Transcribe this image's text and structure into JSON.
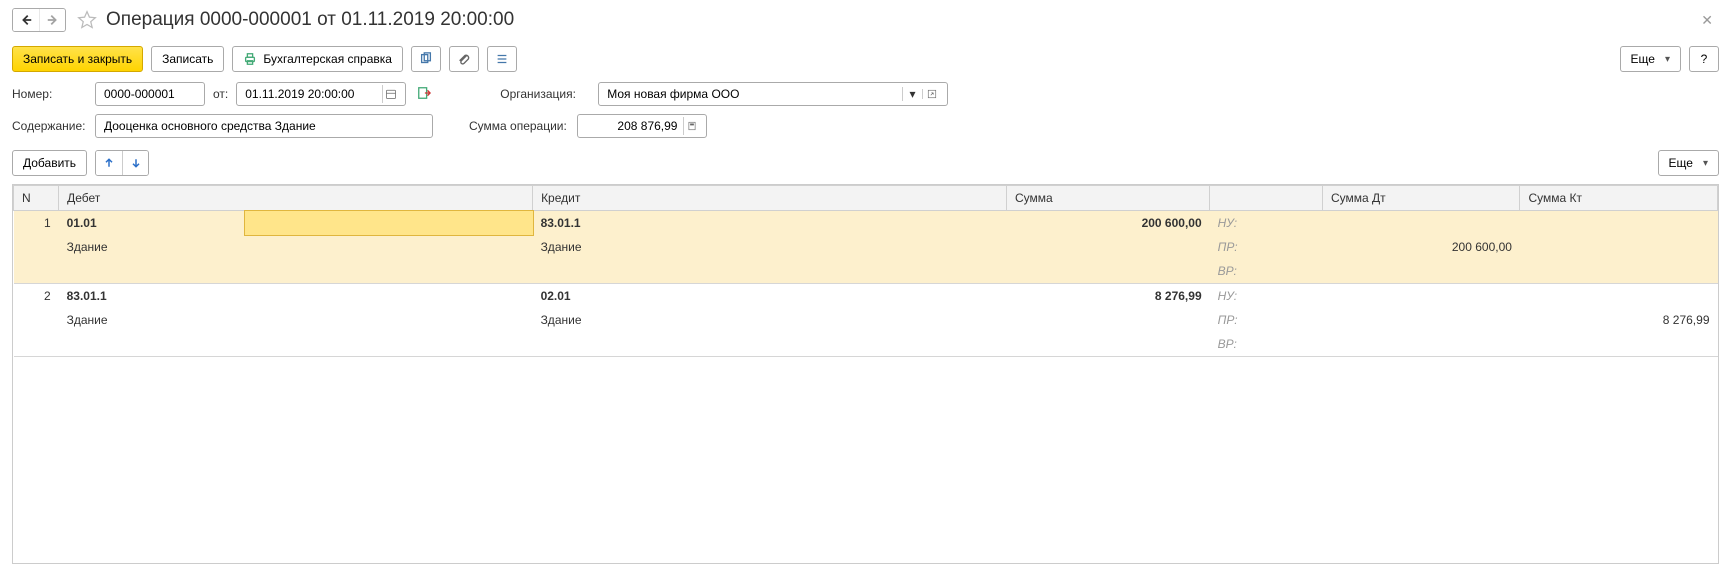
{
  "title": "Операция 0000-000001 от 01.11.2019 20:00:00",
  "toolbar": {
    "save_close": "Записать и закрыть",
    "save": "Записать",
    "print_ref": "Бухгалтерская справка",
    "more": "Еще",
    "help": "?"
  },
  "form": {
    "number_label": "Номер:",
    "number_value": "0000-000001",
    "from_label": "от:",
    "date_value": "01.11.2019 20:00:00",
    "org_label": "Организация:",
    "org_value": "Моя новая фирма ООО",
    "content_label": "Содержание:",
    "content_value": "Дооценка основного средства Здание",
    "op_sum_label": "Сумма операции:",
    "op_sum_value": "208 876,99"
  },
  "table_toolbar": {
    "add": "Добавить",
    "more": "Еще"
  },
  "columns": {
    "n": "N",
    "debit": "Дебет",
    "credit": "Кредит",
    "sum": "Сумма",
    "sum_dt": "Сумма Дт",
    "sum_kt": "Сумма Кт"
  },
  "tax_labels": {
    "nu": "НУ:",
    "pr": "ПР:",
    "vr": "ВР:"
  },
  "rows": [
    {
      "n": "1",
      "debit_acc": "01.01",
      "debit_sub": "Здание",
      "credit_acc": "83.01.1",
      "credit_sub": "Здание",
      "sum": "200 600,00",
      "sum_dt_pr": "200 600,00",
      "sum_kt_pr": ""
    },
    {
      "n": "2",
      "debit_acc": "83.01.1",
      "debit_sub": "Здание",
      "credit_acc": "02.01",
      "credit_sub": "Здание",
      "sum": "8 276,99",
      "sum_dt_pr": "",
      "sum_kt_pr": "8 276,99"
    }
  ]
}
